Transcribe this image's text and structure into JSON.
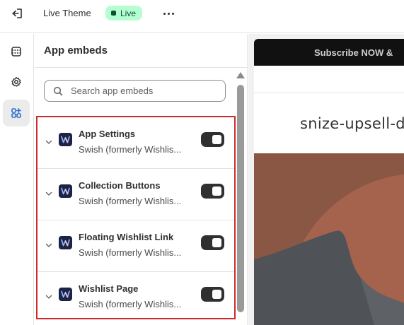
{
  "topbar": {
    "exit_icon": "exit-icon",
    "theme_name": "Live Theme",
    "live_badge": "Live",
    "more_icon": "more-horizontal-icon"
  },
  "rail": {
    "items": [
      {
        "icon": "sections-icon",
        "active": false
      },
      {
        "icon": "gear-icon",
        "active": false
      },
      {
        "icon": "app-embeds-icon",
        "active": true
      }
    ]
  },
  "panel": {
    "title": "App embeds",
    "search": {
      "placeholder": "Search app embeds",
      "value": ""
    },
    "embeds": [
      {
        "title": "App Settings",
        "subtitle": "Swish (formerly Wishlis...",
        "enabled": true
      },
      {
        "title": "Collection Buttons",
        "subtitle": "Swish (formerly Wishlis...",
        "enabled": true
      },
      {
        "title": "Floating Wishlist Link",
        "subtitle": "Swish (formerly Wishlis...",
        "enabled": true
      },
      {
        "title": "Wishlist Page",
        "subtitle": "Swish (formerly Wishlis...",
        "enabled": true
      }
    ]
  },
  "preview": {
    "announcement": "Subscribe NOW &",
    "store_name": "snize-upsell-d",
    "colors": {
      "hero_bg": "#8a5744",
      "hero_shape": "#a5634d",
      "hero_dark": "#4f5257"
    }
  },
  "colors": {
    "live_badge_bg": "#b4fed2",
    "live_badge_text": "#0c5132",
    "highlight_border": "#d02a2a",
    "toggle_on": "#303030"
  }
}
